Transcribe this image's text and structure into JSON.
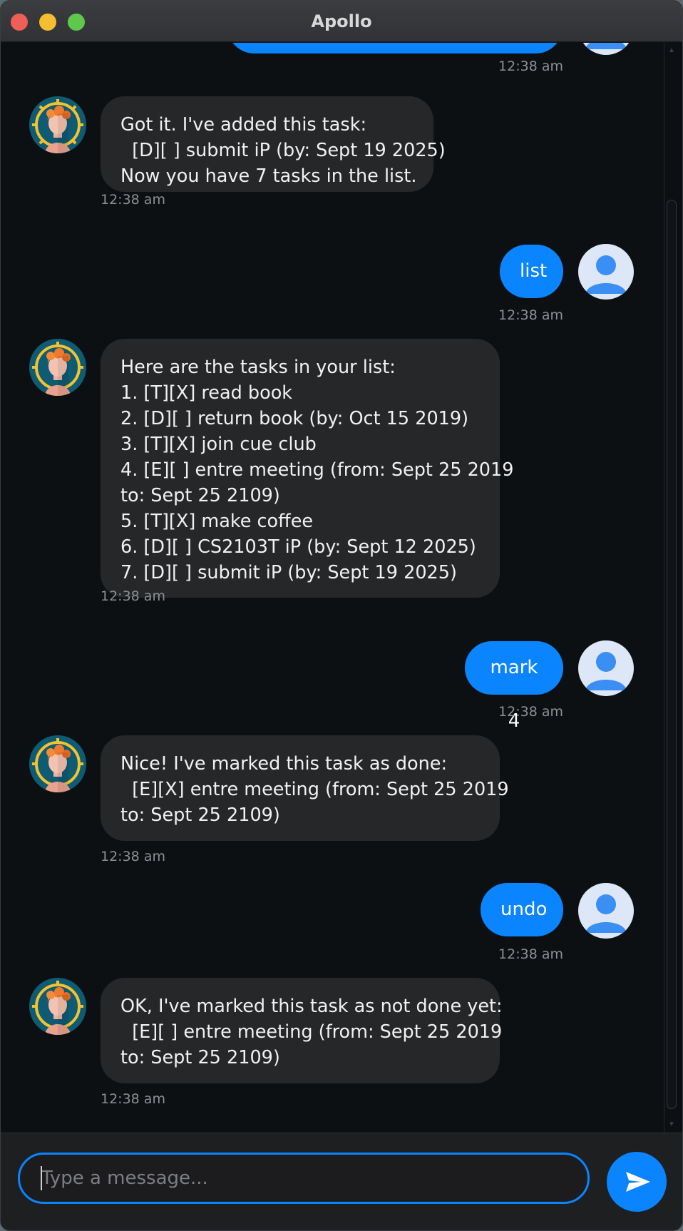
{
  "window": {
    "title": "Apollo"
  },
  "messages": [
    {
      "sender": "bot",
      "text": "Got it. I've added this task:\n  [D][ ] submit iP (by: Sept 19 2025)\nNow you have 7 tasks in the list.",
      "time": "12:38 am"
    },
    {
      "sender": "user",
      "text": "list",
      "time": "12:38 am"
    },
    {
      "sender": "bot",
      "text": "Here are the tasks in your list:\n1. [T][X] read book\n2. [D][ ] return book (by: Oct 15 2019)\n3. [T][X] join cue club\n4. [E][ ] entre meeting (from: Sept 25 2019\nto: Sept 25 2109)\n5. [T][X] make coffee\n6. [D][ ] CS2103T iP (by: Sept 12 2025)\n7. [D][ ] submit iP (by: Sept 19 2025)",
      "time": "12:38 am"
    },
    {
      "sender": "user",
      "text": "mark 4",
      "time": "12:38 am"
    },
    {
      "sender": "bot",
      "text": "Nice! I've marked this task as done:\n  [E][X] entre meeting (from: Sept 25 2019\nto: Sept 25 2109)",
      "time": "12:38 am"
    },
    {
      "sender": "user",
      "text": "undo",
      "time": "12:38 am"
    },
    {
      "sender": "bot",
      "text": "OK, I've marked this task as not done yet:\n  [E][ ] entre meeting (from: Sept 25 2019\nto: Sept 25 2109)",
      "time": "12:38 am"
    }
  ],
  "top_partial_time": "12:38 am",
  "composer": {
    "placeholder": "Type a message...",
    "value": ""
  },
  "icons": {
    "close": "close-traffic-light",
    "minimize": "minimize-traffic-light",
    "maximize": "maximize-traffic-light",
    "bot_avatar": "bot-avatar-icon",
    "user_avatar": "user-avatar-icon",
    "send": "send-icon"
  },
  "colors": {
    "accent": "#0a84ff",
    "bot_bubble": "#262729",
    "background": "#0d1013"
  }
}
